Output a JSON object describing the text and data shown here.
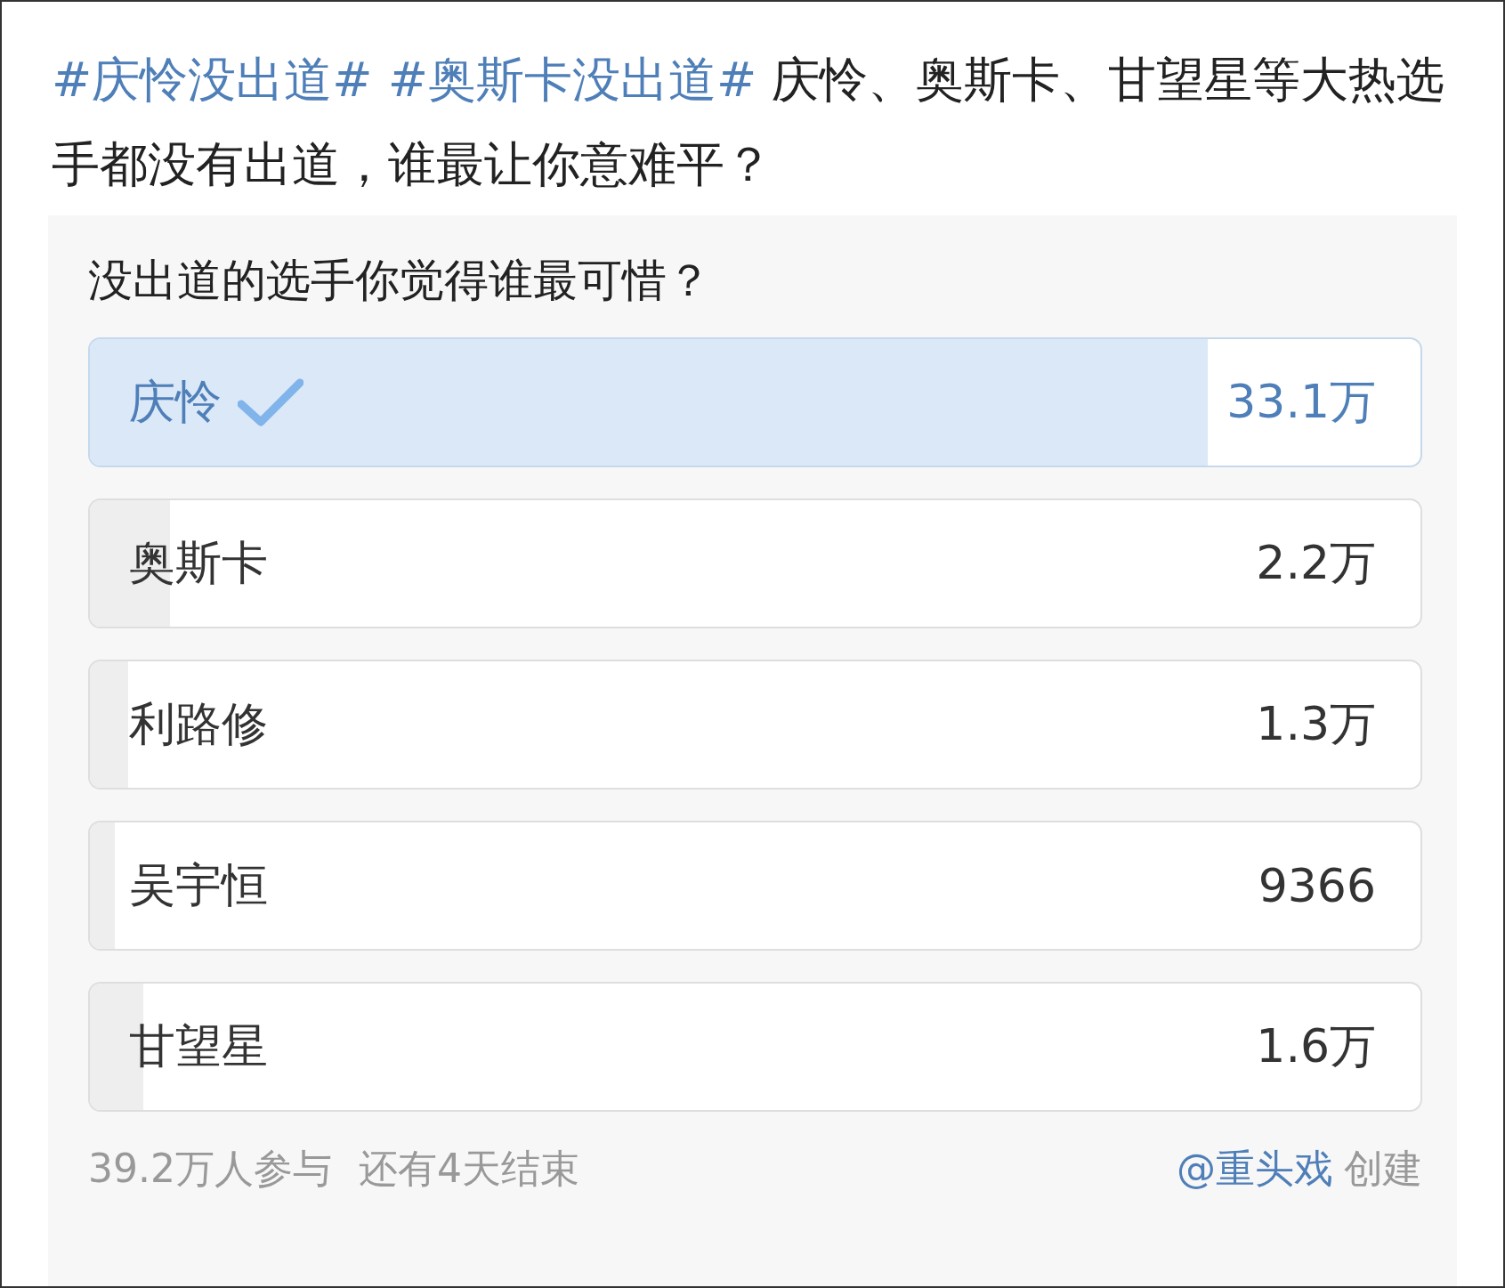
{
  "post": {
    "text": "**#庆怜没出道# #奥斯卡没出道#** 庆怜、奥斯卡、甘望星等大热选手都没有出道，谁最让你意难平？"
  },
  "poll": {
    "question": "没出道的选手你觉得谁最可惜？",
    "options": [
      {
        "name": "庆怜",
        "count": "33.1万",
        "level": 0.84,
        "selected": true
      },
      {
        "name": "奥斯卡",
        "count": "2.2万",
        "level": 0.06,
        "selected": false
      },
      {
        "name": "利路修",
        "count": "1.3万",
        "level": 0.029,
        "selected": false
      },
      {
        "name": "吴宇恒",
        "count": "9366",
        "level": 0.019,
        "selected": false
      },
      {
        "name": "甘望星",
        "count": "1.6万",
        "level": 0.04,
        "selected": false
      }
    ],
    "participants": "39.2万人参与",
    "remaining": "还有4天结束",
    "creator": "@重头戏",
    "created": "创建"
  }
}
